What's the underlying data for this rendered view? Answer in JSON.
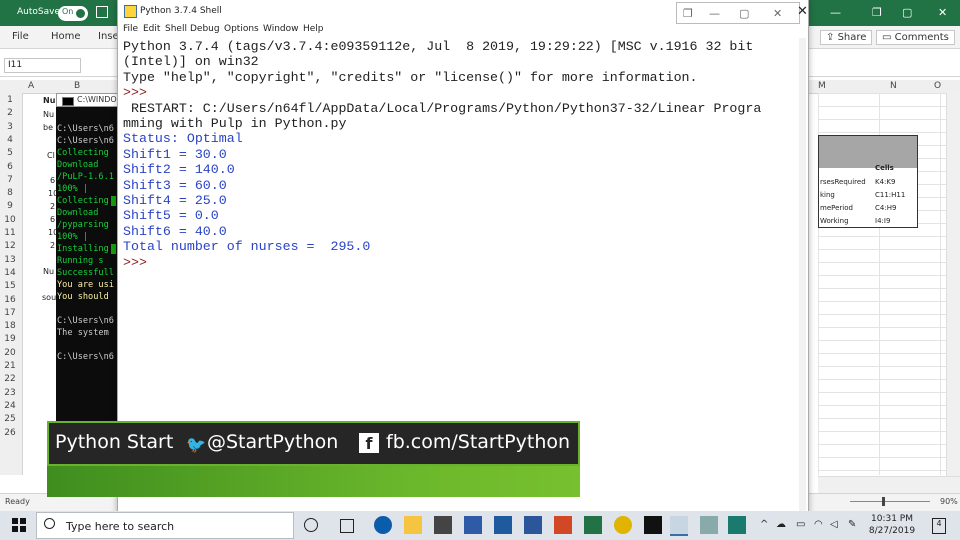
{
  "excel": {
    "autosave_label": "AutoSave",
    "autosave_state": "On",
    "ribbon_tabs": [
      "File",
      "Home",
      "Inse"
    ],
    "share_label": "Share",
    "comments_label": "Comments",
    "namebox_value": "I11",
    "col_headers": [
      "A",
      "B",
      "M",
      "N",
      "O"
    ],
    "rows": [
      "1",
      "2",
      "3",
      "4",
      "5",
      "6",
      "7",
      "8",
      "9",
      "10",
      "11",
      "12",
      "13",
      "14",
      "15",
      "16",
      "17",
      "18",
      "19",
      "20",
      "21",
      "22",
      "23",
      "24",
      "25",
      "26"
    ],
    "cells": {
      "b1": "Nu",
      "b1b": "Nu",
      "b2": "be",
      "b3": "Cl",
      "b4": "6",
      "b5": "10",
      "b6": "2",
      "b7": "6",
      "b8": "10",
      "b9": "2",
      "b11": "Nu",
      "b13": "sou"
    },
    "right_table": {
      "header": "Cells",
      "rows": [
        {
          "name": "rsesRequired",
          "cells": "K4:K9"
        },
        {
          "name": "king",
          "cells": "C11:H11"
        },
        {
          "name": "mePeriod",
          "cells": "C4:H9"
        },
        {
          "name": "Working",
          "cells": "I4:I9"
        }
      ]
    },
    "status": "Ready",
    "zoom": "90%"
  },
  "cmd": {
    "title": "C:\\WINDO",
    "lines": [
      {
        "t": "C:\\Users\\n6",
        "c": "cgray"
      },
      {
        "t": "C:\\Users\\n6",
        "c": "cgray"
      },
      {
        "t": "Collecting",
        "c": "cgreen"
      },
      {
        "t": "  Download",
        "c": "cgreen"
      },
      {
        "t": "/PuLP-1.6.1",
        "c": "cgreen"
      },
      {
        "t": "    100% |",
        "c": "cgreen"
      },
      {
        "t": "Collecting",
        "c": "cgreen"
      },
      {
        "t": "  Download",
        "c": "cgreen"
      },
      {
        "t": "/pyparsing",
        "c": "cgreen"
      },
      {
        "t": "    100% |",
        "c": "cgreen"
      },
      {
        "t": "Installing",
        "c": "cgreen"
      },
      {
        "t": "  Running s",
        "c": "cgreen"
      },
      {
        "t": "Successfull",
        "c": "cgreen"
      },
      {
        "t": "You are usi",
        "c": "cyel"
      },
      {
        "t": "You should ",
        "c": "cyel"
      },
      {
        "t": "",
        "c": "cgray"
      },
      {
        "t": "C:\\Users\\n6",
        "c": "cgray"
      },
      {
        "t": "The system ",
        "c": "cgray"
      },
      {
        "t": "",
        "c": "cgray"
      },
      {
        "t": "C:\\Users\\n6",
        "c": "cgray"
      }
    ]
  },
  "idle": {
    "title": "Python 3.7.4 Shell",
    "menu": [
      "File",
      "Edit",
      "Shell",
      "Debug",
      "Options",
      "Window",
      "Help"
    ],
    "lines": [
      {
        "t": "Python 3.7.4 (tags/v3.7.4:e09359112e, Jul  8 2019, 19:29:22) [MSC v.1916 32 bit",
        "c": "k"
      },
      {
        "t": "(Intel)] on win32",
        "c": "k"
      },
      {
        "t": "Type \"help\", \"copyright\", \"credits\" or \"license()\" for more information.",
        "c": "k"
      },
      {
        "t": ">>> ",
        "c": "pr"
      },
      {
        "t": " RESTART: C:/Users/n64fl/AppData/Local/Programs/Python/Python37-32/Linear Progra",
        "c": "k"
      },
      {
        "t": "mming with Pulp in Python.py",
        "c": "k"
      },
      {
        "t": "Status: Optimal",
        "c": "o"
      },
      {
        "t": "Shift1 = 30.0",
        "c": "o"
      },
      {
        "t": "Shift2 = 140.0",
        "c": "o"
      },
      {
        "t": "Shift3 = 60.0",
        "c": "o"
      },
      {
        "t": "Shift4 = 25.0",
        "c": "o"
      },
      {
        "t": "Shift5 = 0.0",
        "c": "o"
      },
      {
        "t": "Shift6 = 40.0",
        "c": "o"
      },
      {
        "t": "Total number of nurses =  295.0",
        "c": "o"
      },
      {
        "t": ">>> ",
        "c": "pr"
      }
    ]
  },
  "banner": {
    "name": "Python Start",
    "twitter": "@StartPython",
    "facebook": "fb.com/StartPython"
  },
  "taskbar": {
    "search_placeholder": "Type here to search",
    "time": "10:31 PM",
    "date": "8/27/2019",
    "notifications": "4"
  }
}
